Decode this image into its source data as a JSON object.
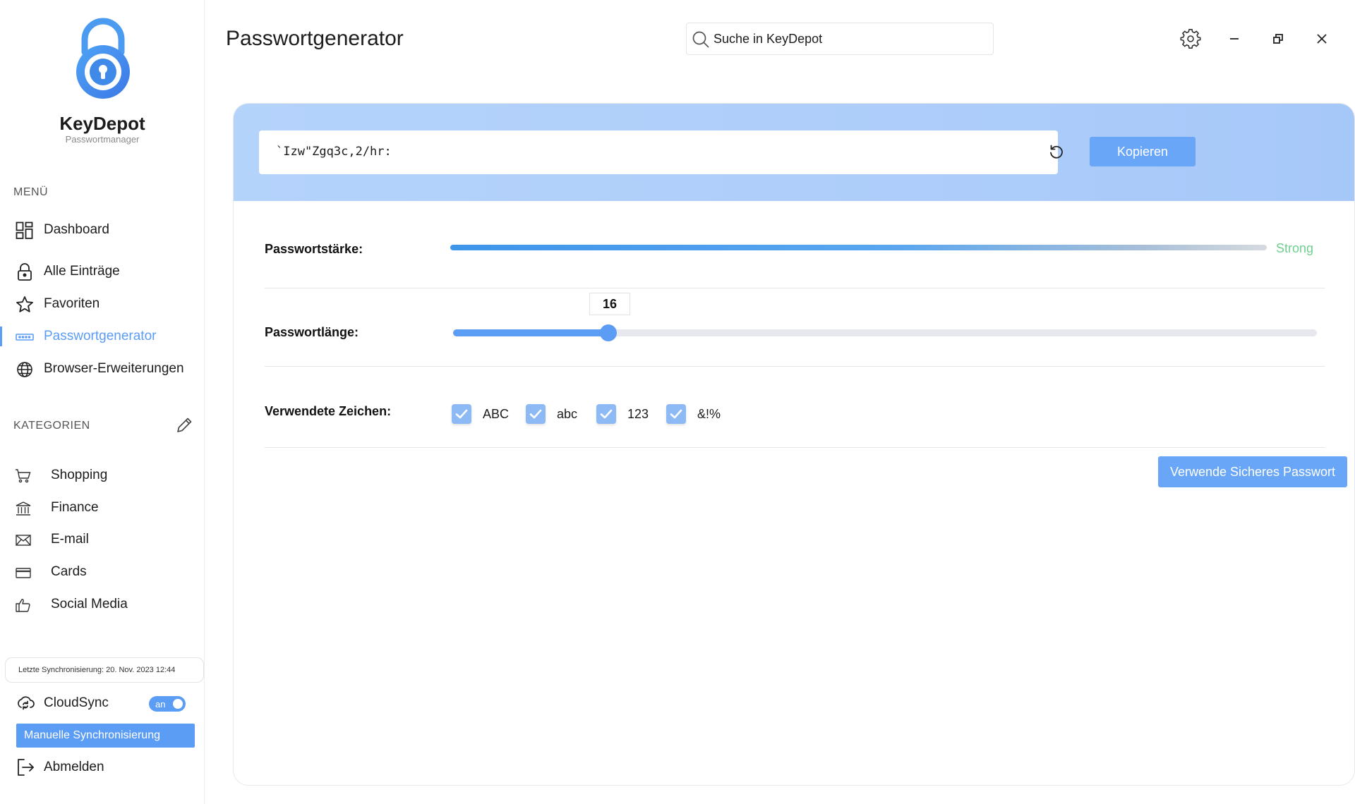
{
  "app": {
    "name": "KeyDepot",
    "subtitle": "Passwortmanager"
  },
  "sidebar": {
    "menu_label": "MENÜ",
    "menu_items": [
      {
        "label": "Dashboard",
        "icon": "dashboard-icon",
        "active": false
      },
      {
        "label": "Alle Einträge",
        "icon": "lock-icon",
        "active": false
      },
      {
        "label": "Favoriten",
        "icon": "star-icon",
        "active": false
      },
      {
        "label": "Passwortgenerator",
        "icon": "password-dots-icon",
        "active": true
      },
      {
        "label": "Browser-Erweiterungen",
        "icon": "globe-icon",
        "active": false
      }
    ],
    "categories_label": "KATEGORIEN",
    "categories": [
      {
        "label": "Shopping",
        "icon": "cart-icon"
      },
      {
        "label": "Finance",
        "icon": "bank-icon"
      },
      {
        "label": "E-mail",
        "icon": "mail-icon"
      },
      {
        "label": "Cards",
        "icon": "credit-card-icon"
      },
      {
        "label": "Social Media",
        "icon": "thumbs-up-icon"
      }
    ],
    "last_sync": "Letzte Synchronisierung: 20. Nov. 2023 12:44",
    "cloudsync_label": "CloudSync",
    "cloudsync_toggle": "an",
    "manual_sync_label": "Manuelle Synchronisierung",
    "logout_label": "Abmelden"
  },
  "header": {
    "title": "Passwortgenerator",
    "search_placeholder": "Suche in KeyDepot"
  },
  "generator": {
    "password": "`Izw\"Zgq3c,2/hr:",
    "copy_label": "Kopieren",
    "strength_label": "Passwortstärke:",
    "strength_value": "Strong",
    "length_label": "Passwortlänge:",
    "length_value": "16",
    "length_fraction": 0.18,
    "chars_label": "Verwendete  Zeichen:",
    "char_options": [
      {
        "label": "ABC",
        "checked": true
      },
      {
        "label": "abc",
        "checked": true
      },
      {
        "label": "123",
        "checked": true
      },
      {
        "label": "&!%",
        "checked": true
      }
    ],
    "use_label": "Verwende Sicheres Passwort"
  },
  "colors": {
    "accent": "#5b9cf5",
    "strength_good": "#6fcf8f",
    "header_gradient": "#b4d3fb"
  }
}
